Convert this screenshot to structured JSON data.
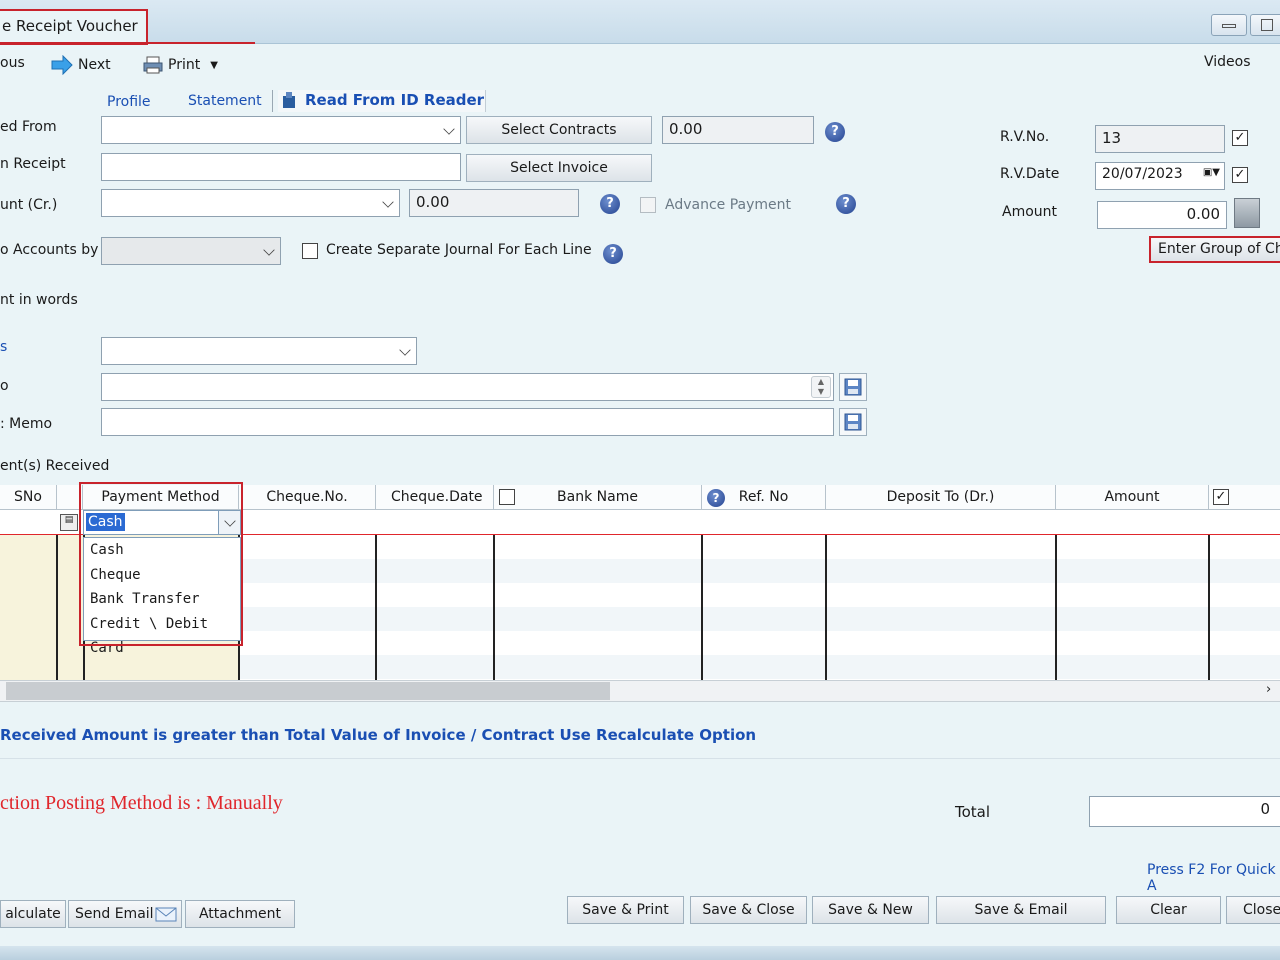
{
  "window": {
    "title": "e Receipt Voucher"
  },
  "toolbar": {
    "previous_label": "ous",
    "next_label": "Next",
    "print_label": "Print",
    "videos_label": "Videos"
  },
  "links": {
    "profile": "Profile",
    "statement": "Statement",
    "read_id": "Read From ID Reader"
  },
  "form": {
    "received_from_label": "ed From",
    "on_receipt_label": "n Receipt",
    "account_label": "unt (Cr.)",
    "to_accounts_label": "o Accounts by",
    "amount_words_label": "nt in words",
    "field_a_label": "s",
    "memo_label": "o",
    "print_memo_label": ": Memo",
    "select_contracts": "Select Contracts",
    "select_invoice": "Select Invoice",
    "contracts_value": "0.00",
    "account_value": "0.00",
    "advance_payment": "Advance Payment",
    "separate_journal": "Create Separate Journal For Each Line"
  },
  "voucher": {
    "rv_no_label": "R.V.No.",
    "rv_no_value": "13",
    "rv_date_label": "R.V.Date",
    "rv_date_value": "20/07/2023",
    "amount_label": "Amount",
    "amount_value": "0.00",
    "group_cheques": "Enter Group of Che"
  },
  "payments": {
    "section_label": "ent(s) Received",
    "columns": {
      "sno": "SNo",
      "payment_method": "Payment Method",
      "cheque_no": "Cheque.No.",
      "cheque_date": "Cheque.Date",
      "bank_name": "Bank Name",
      "ref_no": "Ref. No",
      "deposit_to": "Deposit To (Dr.)",
      "amount": "Amount"
    },
    "current_method": "Cash",
    "options": [
      "Cash",
      "Cheque",
      "Bank Transfer",
      "Credit \\ Debit Card"
    ]
  },
  "messages": {
    "warning": "Received Amount is greater than Total Value of Invoice / Contract Use Recalculate Option",
    "posting": "ction Posting Method is : Manually",
    "shortcut": "Press F2 For Quick A"
  },
  "totals": {
    "total_label": "Total",
    "total_value": "0"
  },
  "footer": {
    "recalculate": "alculate",
    "send_email": "Send Email",
    "attachment": "Attachment",
    "save_print": "Save & Print",
    "save_close": "Save & Close",
    "save_new": "Save & New",
    "save_email": "Save & Email",
    "clear": "Clear",
    "close": "Close"
  },
  "colors": {
    "accent_red": "#c8232c",
    "link_blue": "#1a4fb3",
    "posting_red": "#e0262c",
    "grid_row_tint": "#f7f3dc"
  }
}
